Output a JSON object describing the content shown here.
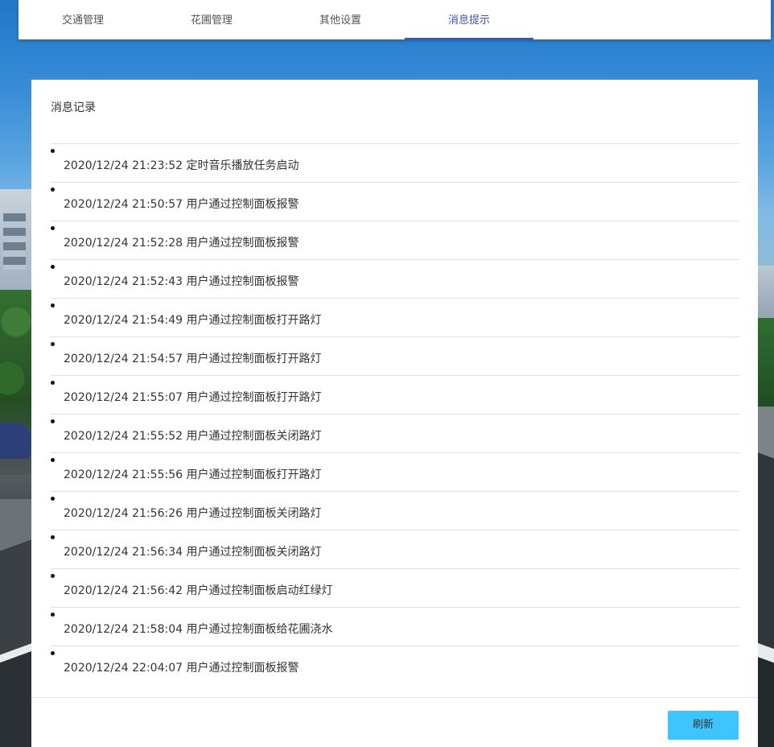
{
  "tabs": [
    {
      "label": "交通管理",
      "active": false
    },
    {
      "label": "花圃管理",
      "active": false
    },
    {
      "label": "其他设置",
      "active": false
    },
    {
      "label": "消息提示",
      "active": true
    }
  ],
  "colors": {
    "accent": "#3f51b5",
    "button": "#3ec5ff"
  },
  "panel": {
    "title": "消息记录",
    "refresh_label": "刷新",
    "messages": [
      "2020/12/24 21:23:52 定时音乐播放任务启动",
      "2020/12/24 21:50:57 用户通过控制面板报警",
      "2020/12/24 21:52:28 用户通过控制面板报警",
      "2020/12/24 21:52:43 用户通过控制面板报警",
      "2020/12/24 21:54:49 用户通过控制面板打开路灯",
      "2020/12/24 21:54:57 用户通过控制面板打开路灯",
      "2020/12/24 21:55:07 用户通过控制面板打开路灯",
      "2020/12/24 21:55:52 用户通过控制面板关闭路灯",
      "2020/12/24 21:55:56 用户通过控制面板打开路灯",
      "2020/12/24 21:56:26 用户通过控制面板关闭路灯",
      "2020/12/24 21:56:34 用户通过控制面板关闭路灯",
      "2020/12/24 21:56:42 用户通过控制面板启动红绿灯",
      "2020/12/24 21:58:04 用户通过控制面板给花圃浇水",
      "2020/12/24 22:04:07 用户通过控制面板报警"
    ]
  }
}
